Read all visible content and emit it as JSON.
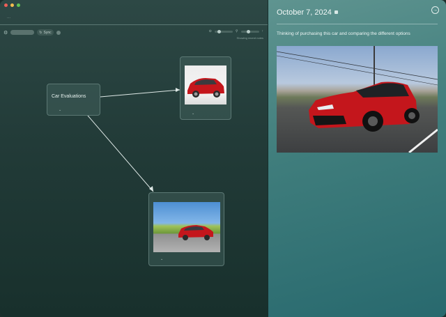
{
  "window": {
    "title_handle": "..."
  },
  "toolbar": {
    "search_value": "",
    "sync_label": "Sync",
    "status_text": "Showing recent notes"
  },
  "canvas": {
    "nodes": [
      {
        "id": "car-evaluations",
        "title": "Car Evaluations",
        "chevron": "⌄"
      },
      {
        "id": "image-node-1",
        "chevron": "⌄"
      },
      {
        "id": "image-node-2",
        "chevron": "⌄"
      }
    ]
  },
  "detail": {
    "date": "October 7, 2024",
    "note": "Thinking of purchasing this car and comparing the different options",
    "nav_icon": "arrow-right-circle-icon"
  },
  "colors": {
    "canvas_bg": "#223b38",
    "panel_bg": "#3f7d7c",
    "car_red": "#c4161c"
  }
}
